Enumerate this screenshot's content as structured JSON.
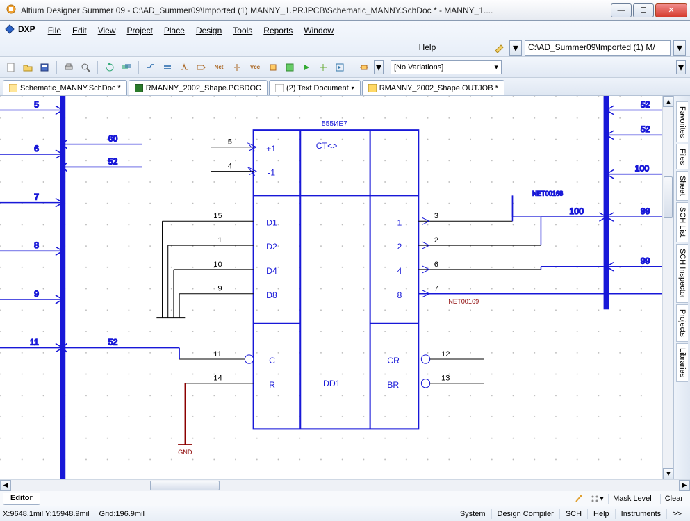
{
  "title": "Altium Designer Summer 09 - C:\\AD_Summer09\\Imported (1) MANNY_1.PRJPCB\\Schematic_MANNY.SchDoc * - MANNY_1....",
  "menus": {
    "dxp": "DXP",
    "file": "File",
    "edit": "Edit",
    "view": "View",
    "project": "Project",
    "place": "Place",
    "design": "Design",
    "tools": "Tools",
    "reports": "Reports",
    "window": "Window",
    "help": "Help"
  },
  "path_box": "C:\\AD_Summer09\\Imported (1) M/",
  "variations": "[No Variations]",
  "doc_tabs": [
    {
      "label": "Schematic_MANNY.SchDoc *",
      "kind": "sch"
    },
    {
      "label": "RMANNY_2002_Shape.PCBDOC",
      "kind": "pcb"
    },
    {
      "label": "(2) Text Document",
      "kind": "txt"
    },
    {
      "label": "RMANNY_2002_Shape.OUTJOB *",
      "kind": "out"
    }
  ],
  "side_panels": [
    "Favorites",
    "Files",
    "Sheet",
    "SCH List",
    "SCH Inspector",
    "Projects",
    "Libraries"
  ],
  "editor_tab": "Editor",
  "editor_right": {
    "mask": "Mask Level",
    "clear": "Clear"
  },
  "status": {
    "coords": "X:9648.1mil Y:15948.9mil",
    "grid": "Grid:196.9mil",
    "buttons": [
      "System",
      "Design Compiler",
      "SCH",
      "Help",
      "Instruments",
      ">>"
    ]
  },
  "schematic": {
    "part_ref": "555ИЕ7",
    "designator": "DD1",
    "center_label": "CT<>",
    "gnd": "GND",
    "left_bus_nets": [
      "5",
      "6",
      "7",
      "8",
      "9",
      "11"
    ],
    "left_stub_nets": {
      "n60": "60",
      "n52a": "52",
      "n52b": "52"
    },
    "right_bus_nets_top": [
      "52",
      "52",
      "100",
      "99",
      "99"
    ],
    "right_bus_join": "100",
    "net_lbl_168": "NET00168",
    "net_lbl_169": "NET00169",
    "left_pins": [
      {
        "num": "5",
        "name": "+1"
      },
      {
        "num": "4",
        "name": "-1"
      },
      {
        "num": "15",
        "name": "D1"
      },
      {
        "num": "1",
        "name": "D2"
      },
      {
        "num": "10",
        "name": "D4"
      },
      {
        "num": "9",
        "name": "D8"
      },
      {
        "num": "11",
        "name": "C"
      },
      {
        "num": "14",
        "name": "R"
      }
    ],
    "right_pins": [
      {
        "num": "3",
        "name": "1"
      },
      {
        "num": "2",
        "name": "2"
      },
      {
        "num": "6",
        "name": "4"
      },
      {
        "num": "7",
        "name": "8"
      },
      {
        "num": "12",
        "name": "CR"
      },
      {
        "num": "13",
        "name": "BR"
      }
    ]
  }
}
